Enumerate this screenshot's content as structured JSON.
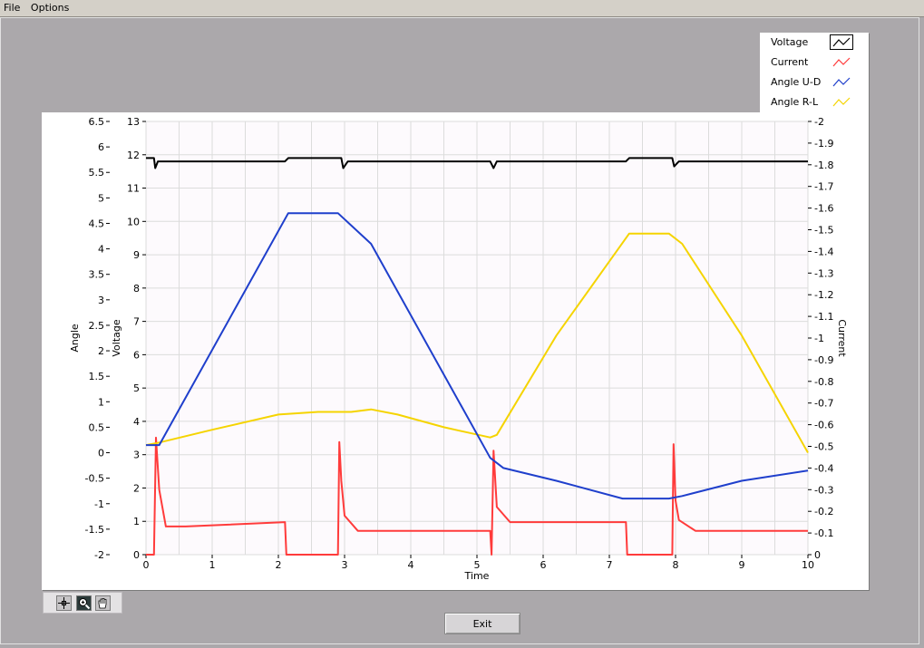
{
  "menu": {
    "file": "File",
    "options": "Options"
  },
  "legend": [
    {
      "label": "Voltage",
      "color": "#000000"
    },
    {
      "label": "Current",
      "color": "#ff3b3b"
    },
    {
      "label": "Angle U-D",
      "color": "#1f3fcc"
    },
    {
      "label": "Angle R-L",
      "color": "#f5d400"
    }
  ],
  "exit_label": "Exit",
  "chart_data": {
    "type": "line",
    "xlabel": "Time",
    "ylabel_angle": "Angle",
    "ylabel_voltage": "Voltage",
    "ylabel_current": "Current",
    "xlim": [
      0,
      10
    ],
    "ylim_angle": [
      -2,
      6.5
    ],
    "ylim_voltage": [
      0,
      13
    ],
    "ylim_current": [
      -0.1,
      -2
    ],
    "grid": true,
    "legend_position": "top-right, outside plot",
    "x_ticks": [
      "0",
      "1",
      "2",
      "3",
      "4",
      "5",
      "6",
      "7",
      "8",
      "9",
      "10"
    ],
    "angle_ticks": [
      "6.5",
      "6",
      "5.5",
      "5",
      "4.5",
      "4",
      "3.5",
      "3",
      "2.5",
      "2",
      "1.5",
      "1",
      "0.5",
      "0",
      "-0.5",
      "-1",
      "-1.5",
      "-2"
    ],
    "voltage_ticks": [
      "13",
      "12",
      "11",
      "10",
      "9",
      "8",
      "7",
      "6",
      "5",
      "4",
      "3",
      "2",
      "1",
      "0"
    ],
    "current_ticks": [
      "-2",
      "-1.9",
      "-1.8",
      "-1.7",
      "-1.6",
      "-1.5",
      "-1.4",
      "-1.3",
      "-1.2",
      "-1.1",
      "-1",
      "-0.9",
      "-0.8",
      "-0.7",
      "-0.6",
      "-0.5",
      "-0.4",
      "-0.3",
      "-0.2",
      "-0.1",
      "0"
    ],
    "series": [
      {
        "name": "Voltage",
        "axis": "voltage",
        "color": "#000000",
        "x": [
          0,
          0.12,
          0.14,
          0.18,
          0.22,
          2.1,
          2.15,
          2.85,
          2.95,
          2.98,
          3.05,
          5.2,
          5.25,
          5.3,
          5.35,
          7.25,
          7.3,
          7.9,
          7.95,
          7.98,
          8.05,
          10
        ],
        "y": [
          11.9,
          11.9,
          11.6,
          11.8,
          11.8,
          11.8,
          11.9,
          11.9,
          11.9,
          11.6,
          11.8,
          11.8,
          11.6,
          11.8,
          11.8,
          11.8,
          11.9,
          11.9,
          11.9,
          11.65,
          11.8,
          11.8
        ]
      },
      {
        "name": "Current",
        "axis": "current",
        "color": "#ff3b3b",
        "x": [
          0,
          0.12,
          0.15,
          0.2,
          0.3,
          0.6,
          2.1,
          2.12,
          2.9,
          2.92,
          2.95,
          3.0,
          3.2,
          5.2,
          5.22,
          5.25,
          5.3,
          5.5,
          7.25,
          7.27,
          7.95,
          7.97,
          8.0,
          8.05,
          8.3,
          10
        ],
        "y": [
          0,
          0,
          -0.54,
          -0.3,
          -0.13,
          -0.13,
          -0.15,
          0,
          0,
          -0.52,
          -0.34,
          -0.18,
          -0.11,
          -0.11,
          0,
          -0.48,
          -0.22,
          -0.15,
          -0.15,
          0,
          0,
          -0.51,
          -0.25,
          -0.16,
          -0.11,
          -0.11
        ]
      },
      {
        "name": "Angle U-D",
        "axis": "angle",
        "color": "#1f3fcc",
        "x": [
          0,
          0.2,
          2.15,
          2.9,
          3.4,
          5.2,
          5.4,
          6.2,
          7.2,
          7.9,
          8.1,
          9.0,
          10
        ],
        "y": [
          0.15,
          0.15,
          4.7,
          4.7,
          4.1,
          -0.1,
          -0.3,
          -0.55,
          -0.9,
          -0.9,
          -0.85,
          -0.55,
          -0.35
        ]
      },
      {
        "name": "Angle R-L",
        "axis": "angle",
        "color": "#f5d400",
        "x": [
          0,
          0.2,
          1.0,
          2.0,
          2.6,
          3.1,
          3.4,
          3.8,
          4.5,
          5.2,
          5.3,
          6.2,
          7.3,
          7.9,
          8.1,
          9.0,
          10
        ],
        "y": [
          0.15,
          0.2,
          0.45,
          0.75,
          0.8,
          0.8,
          0.85,
          0.75,
          0.5,
          0.3,
          0.35,
          2.3,
          4.3,
          4.3,
          4.1,
          2.3,
          0.0
        ]
      }
    ]
  },
  "colors": {
    "background": "#aba8ab",
    "plot_area": "#fdfafd",
    "grid": "#dcdcdc"
  }
}
